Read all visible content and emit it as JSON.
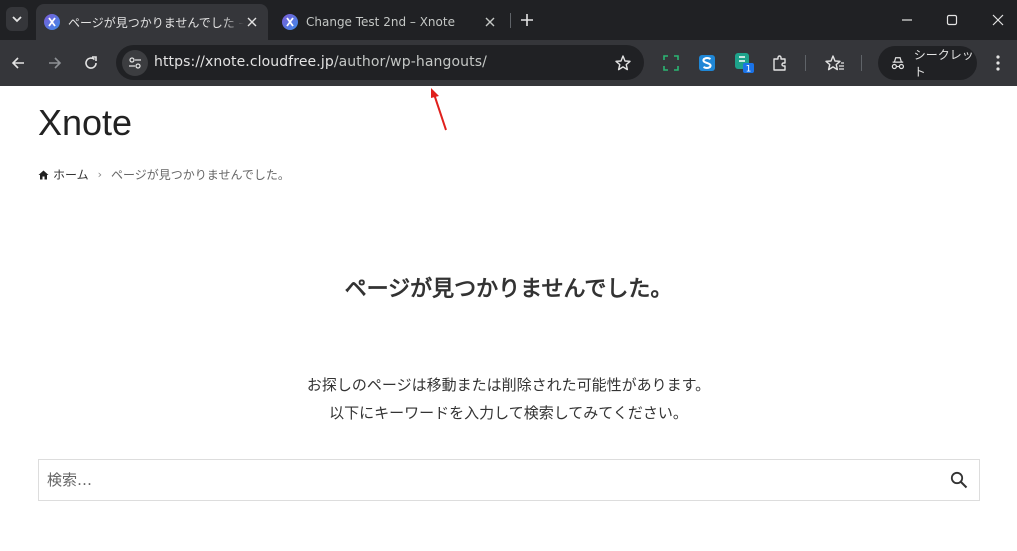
{
  "browser": {
    "tabs": [
      {
        "title": "ページが見つかりませんでした – Xnote",
        "active": true
      },
      {
        "title": "Change Test 2nd – Xnote",
        "active": false
      }
    ],
    "url_host": "https://xnote.cloudfree.jp",
    "url_path": "/author/wp-hangouts/",
    "incognito_label": "シークレット",
    "extension_badge": "1",
    "icons": [
      "tab-search-icon",
      "close-icon",
      "plus-icon",
      "minimize-icon",
      "maximize-icon",
      "back-icon",
      "forward-icon",
      "reload-icon",
      "site-settings-icon",
      "star-icon",
      "screenshot-icon",
      "s-extension-icon",
      "extension-badge-icon",
      "puzzle-icon",
      "bookmarks-icon",
      "incognito-icon",
      "menu-icon"
    ]
  },
  "page": {
    "site_title": "Xnote",
    "breadcrumb": {
      "home": "ホーム",
      "current": "ページが見つかりませんでした。"
    },
    "heading": "ページが見つかりませんでした。",
    "message_line1": "お探しのページは移動または削除された可能性があります。",
    "message_line2": "以下にキーワードを入力して検索してみてください。",
    "search_placeholder": "検索…"
  },
  "colors": {
    "annotation_arrow": "#e0201c",
    "chrome_dark": "#202124",
    "chrome_toolbar": "#35363a"
  }
}
